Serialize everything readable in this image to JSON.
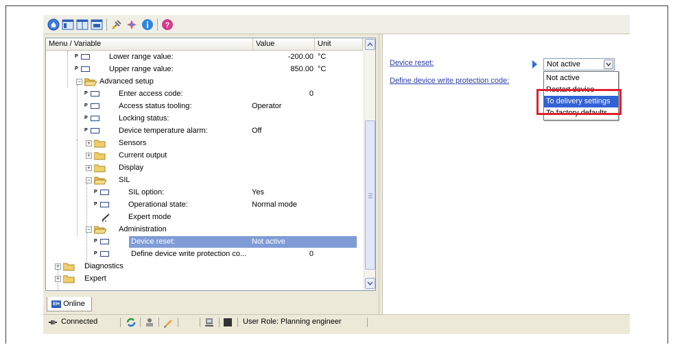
{
  "toolbar": {
    "icons": [
      "home-icon",
      "layout-icon",
      "layout-icon",
      "layout-icon",
      "connect-icon",
      "plus-icon",
      "info-icon",
      "help-icon"
    ]
  },
  "table": {
    "headers": {
      "menu": "Menu / Variable",
      "value": "Value",
      "unit": "Unit"
    },
    "rows": [
      {
        "label": "Lower range value:",
        "value": "-200.00",
        "unit": "°C"
      },
      {
        "label": "Upper range value:",
        "value": "850.00",
        "unit": "°C"
      },
      {
        "label": "Advanced setup"
      },
      {
        "label": "Enter access code:",
        "value": "0"
      },
      {
        "label": "Access status tooling:",
        "value": "Operator"
      },
      {
        "label": "Locking status:"
      },
      {
        "label": "Device temperature alarm:",
        "value": "Off"
      },
      {
        "label": "Sensors"
      },
      {
        "label": "Current output"
      },
      {
        "label": "Display"
      },
      {
        "label": "SIL"
      },
      {
        "label": "SIL option:",
        "value": "Yes"
      },
      {
        "label": "Operational state:",
        "value": "Normal mode"
      },
      {
        "label": "Expert mode"
      },
      {
        "label": "Administration"
      },
      {
        "label": "Device reset:",
        "value": "Not active"
      },
      {
        "label": "Define device write protection co...",
        "value": "0"
      },
      {
        "label": "Diagnostics"
      },
      {
        "label": "Expert"
      }
    ]
  },
  "tabs": {
    "online": "Online"
  },
  "status": {
    "connection": "Connected",
    "user_role": "User Role: Planning engineer"
  },
  "right": {
    "device_reset_label": "Device reset:",
    "write_protect_label": "Define device write protection code:",
    "combo_value": "Not active",
    "options": [
      "Not active",
      "Restart device",
      "To delivery settings",
      "To factory defaults"
    ],
    "highlighted_option": "To delivery settings"
  },
  "colors": {
    "selection": "#7f9cd6",
    "highlight": "#3162d6",
    "annotation": "#e0212e",
    "link": "#2a3da8"
  }
}
